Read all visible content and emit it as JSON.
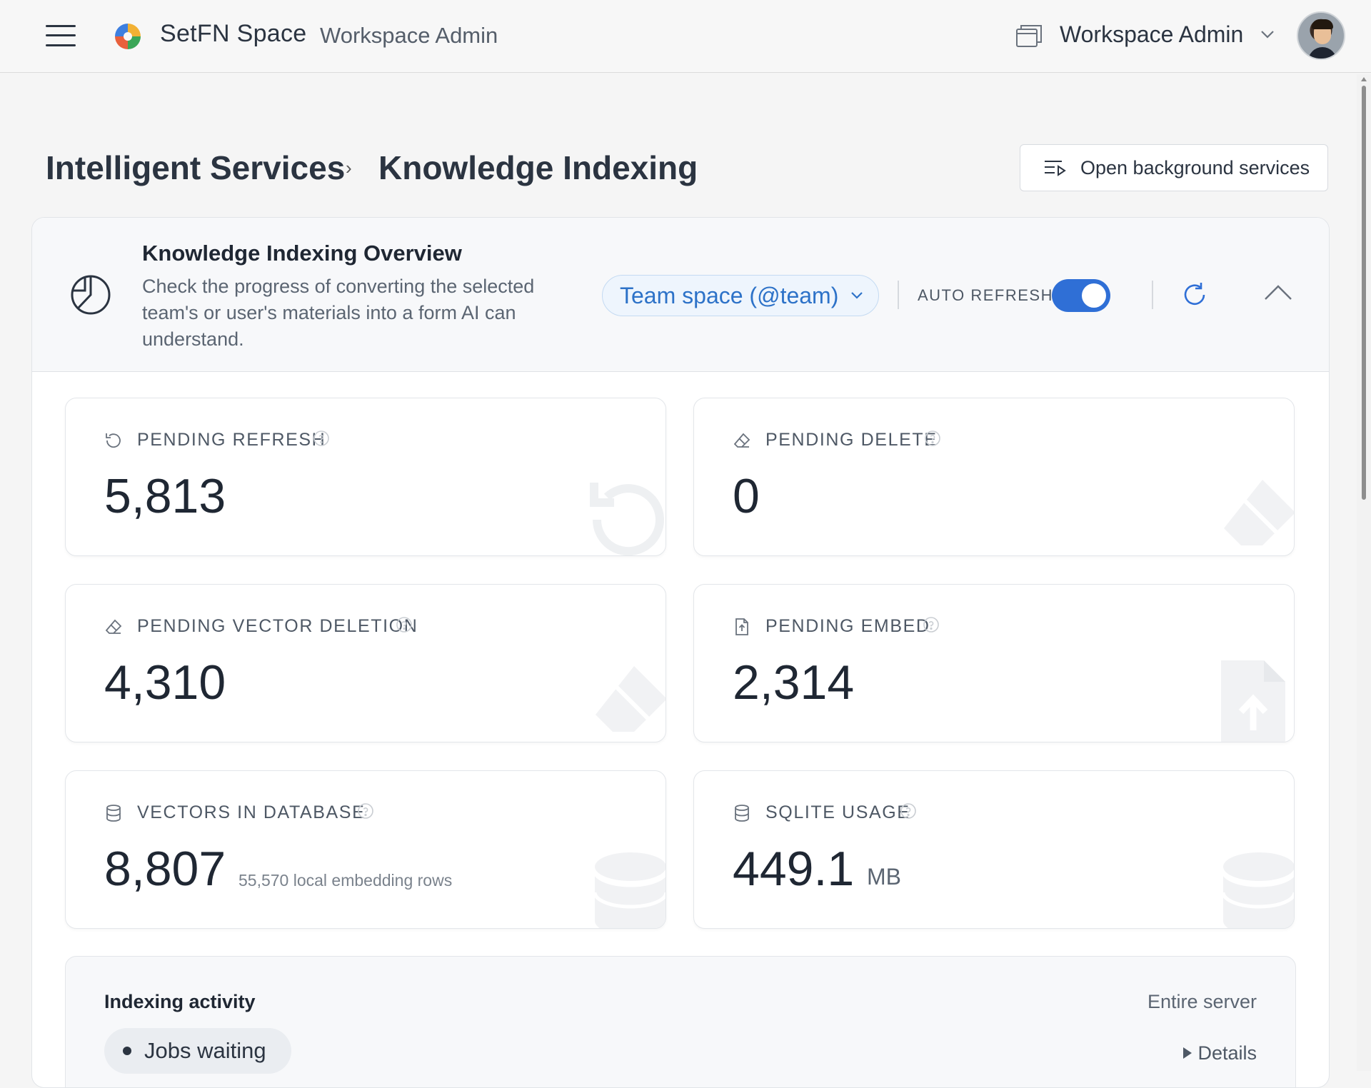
{
  "appbar": {
    "brand_name": "SetFN Space",
    "brand_sub": "Workspace Admin",
    "workspace_name": "Workspace Admin"
  },
  "breadcrumb": {
    "parent": "Intelligent Services",
    "separator": "›",
    "current": "Knowledge Indexing"
  },
  "actions": {
    "open_background_services": "Open background services"
  },
  "overview": {
    "title": "Knowledge Indexing Overview",
    "description": "Check the progress of converting the selected team's or user's materials into a form AI can understand.",
    "scope_select": "Team space (@team)",
    "auto_refresh_label": "AUTO REFRESH",
    "auto_refresh_on": true
  },
  "stats": [
    {
      "label": "PENDING REFRESH",
      "value": "5,813",
      "icon": "refresh-icon"
    },
    {
      "label": "PENDING DELETE",
      "value": "0",
      "icon": "eraser-icon"
    },
    {
      "label": "PENDING VECTOR DELETION",
      "value": "4,310",
      "icon": "eraser-icon"
    },
    {
      "label": "PENDING EMBED",
      "value": "2,314",
      "icon": "file-upload-icon"
    },
    {
      "label": "VECTORS IN DATABASE",
      "value": "8,807",
      "extra": "55,570 local embedding rows",
      "icon": "database-icon"
    },
    {
      "label": "SQLITE USAGE",
      "value": "449.1",
      "unit": "MB",
      "icon": "database-icon"
    }
  ],
  "activity": {
    "title": "Indexing activity",
    "scope": "Entire server",
    "status_pill": "Jobs waiting",
    "details_label": "Details"
  },
  "colors": {
    "accent": "#2f6fd6",
    "select_text": "#2d72c8",
    "text_primary": "#1f2733"
  }
}
